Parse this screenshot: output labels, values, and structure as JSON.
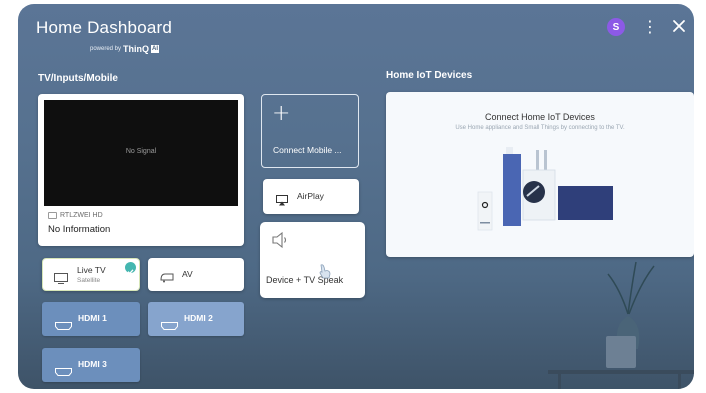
{
  "header": {
    "title": "Home Dashboard",
    "powered_by": "powered by",
    "brand": "ThinQ",
    "brand_badge": "AI",
    "avatar_letter": "S"
  },
  "sections": {
    "inputs": "TV/Inputs/Mobile",
    "iot": "Home IoT Devices"
  },
  "tv": {
    "screen_text": "No Signal",
    "channel": "RTLZWEI HD",
    "info": "No Information"
  },
  "mobile": {
    "connect_label": "Connect Mobile ..."
  },
  "airplay": {
    "label": "AirPlay"
  },
  "speaker": {
    "label": "Device + TV Speak"
  },
  "inputs": {
    "live_tv": {
      "label": "Live TV",
      "sub": "Satellite"
    },
    "av": {
      "label": "AV"
    },
    "hdmi": [
      "HDMI 1",
      "HDMI 2",
      "HDMI 3"
    ]
  },
  "iot": {
    "title": "Connect Home IoT Devices",
    "subtitle": "Use Home appliance and Small Things by connecting to the TV."
  },
  "colors": {
    "accent_avatar": "#8c5ae6",
    "hdmi_bg": "#6c8fbc",
    "hdmi_selected_bg": "#86a4cd",
    "check": "#44b6b0",
    "background": "#5b7596"
  },
  "icons": [
    "close-icon",
    "kebab-menu-icon",
    "plus-icon",
    "airplay-icon",
    "speaker-icon",
    "tv-icon",
    "av-icon",
    "hdmi-icon",
    "check-icon"
  ]
}
